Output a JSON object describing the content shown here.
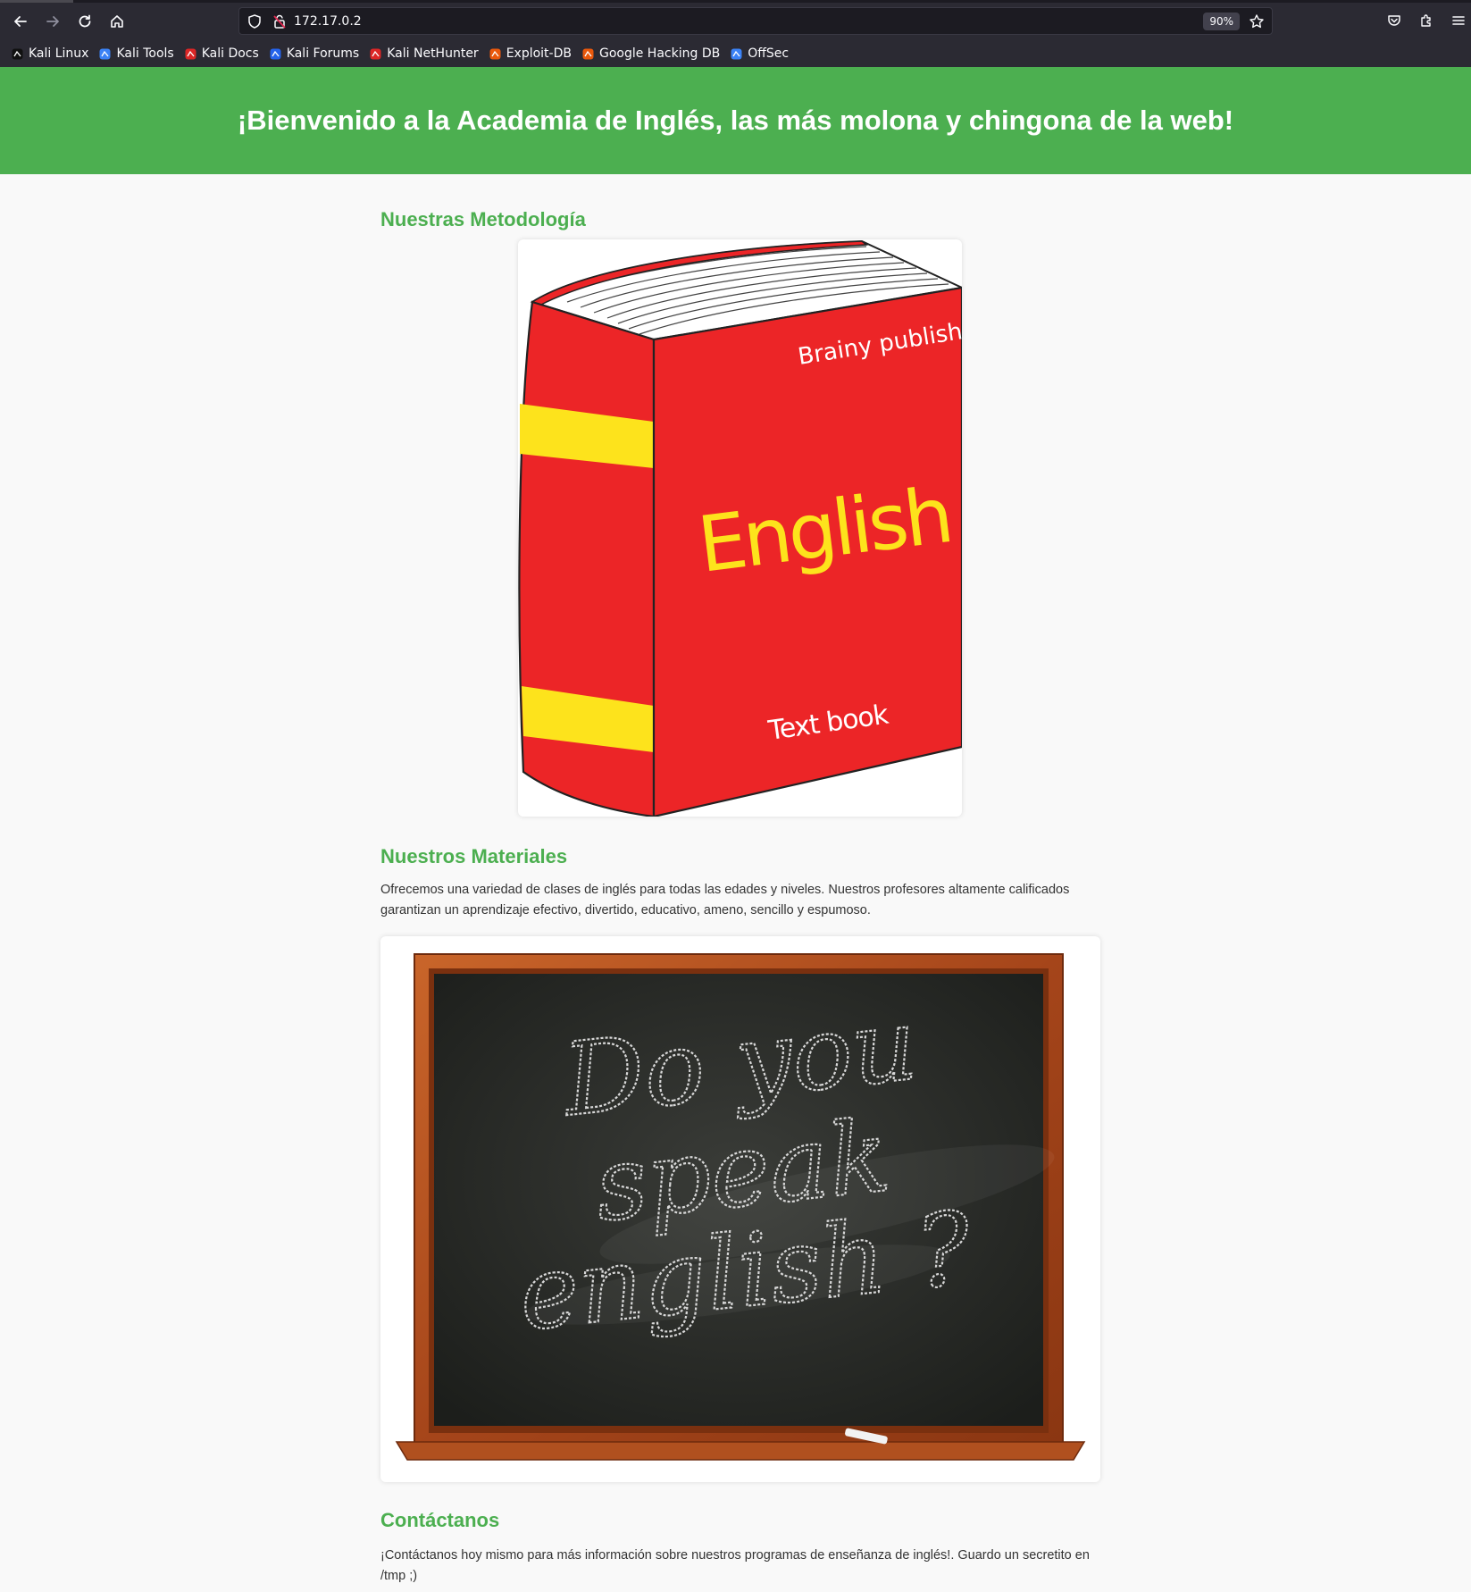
{
  "browser": {
    "url": "172.17.0.2",
    "zoom": "90%",
    "bookmarks": [
      {
        "label": "Kali Linux",
        "icon": "kali-dragon-icon",
        "color": "#111111"
      },
      {
        "label": "Kali Tools",
        "icon": "kali-tools-icon",
        "color": "#3b82f6"
      },
      {
        "label": "Kali Docs",
        "icon": "kali-docs-icon",
        "color": "#dc2626"
      },
      {
        "label": "Kali Forums",
        "icon": "kali-forums-icon",
        "color": "#2563eb"
      },
      {
        "label": "Kali NetHunter",
        "icon": "nethunter-icon",
        "color": "#dc2626"
      },
      {
        "label": "Exploit-DB",
        "icon": "exploit-db-icon",
        "color": "#ea580c"
      },
      {
        "label": "Google Hacking DB",
        "icon": "ghdb-icon",
        "color": "#ea580c"
      },
      {
        "label": "OffSec",
        "icon": "offsec-icon",
        "color": "#3b82f6"
      }
    ]
  },
  "page": {
    "heading": "¡Bienvenido a la Academia de Inglés, las más molona y chingona de la web!",
    "sections": {
      "methodology": {
        "title": "Nuestras Metodología",
        "image": {
          "publisher": "Brainy publishing",
          "title": "English",
          "subtitle": "Text book"
        }
      },
      "materials": {
        "title": "Nuestros Materiales",
        "text": "Ofrecemos una variedad de clases de inglés para todas las edades y niveles. Nuestros profesores altamente calificados garantizan un aprendizaje efectivo, divertido, educativo, ameno, sencillo y espumoso.",
        "image": {
          "line1": "Do you",
          "line2": "speak",
          "line3": "english ?"
        }
      },
      "contact": {
        "title": "Contáctanos",
        "text": "¡Contáctanos hoy mismo para más información sobre nuestros programas de enseñanza de inglés!. Guardo un secretito en /tmp ;)"
      }
    }
  },
  "colors": {
    "header_bg": "#4caf50",
    "accent": "#4caf50",
    "book_red": "#ec2527",
    "book_yellow": "#fde31c",
    "chalkboard": "#2b2d2a",
    "frame_wood": "#b0501f"
  }
}
